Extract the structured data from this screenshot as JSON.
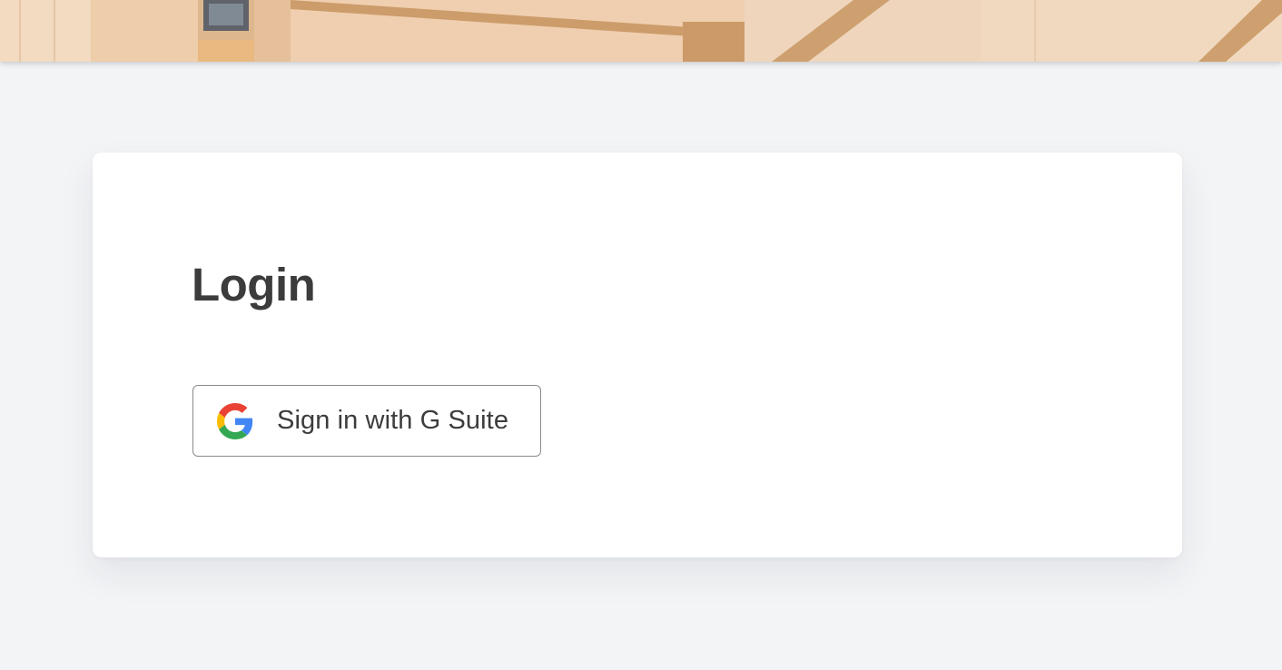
{
  "banner": {
    "colors": {
      "base": "#eecba6",
      "wood": "#c9955e",
      "wall": "#f2dcc4"
    }
  },
  "login": {
    "title": "Login",
    "google_button": {
      "label": "Sign in with G Suite",
      "icon": "google-g-icon"
    }
  },
  "colors": {
    "page_background": "#f3f4f6",
    "card_background": "#ffffff",
    "text": "#3c3c3c",
    "google_blue": "#4285F4",
    "google_red": "#EA4335",
    "google_yellow": "#FBBC05",
    "google_green": "#34A853"
  }
}
